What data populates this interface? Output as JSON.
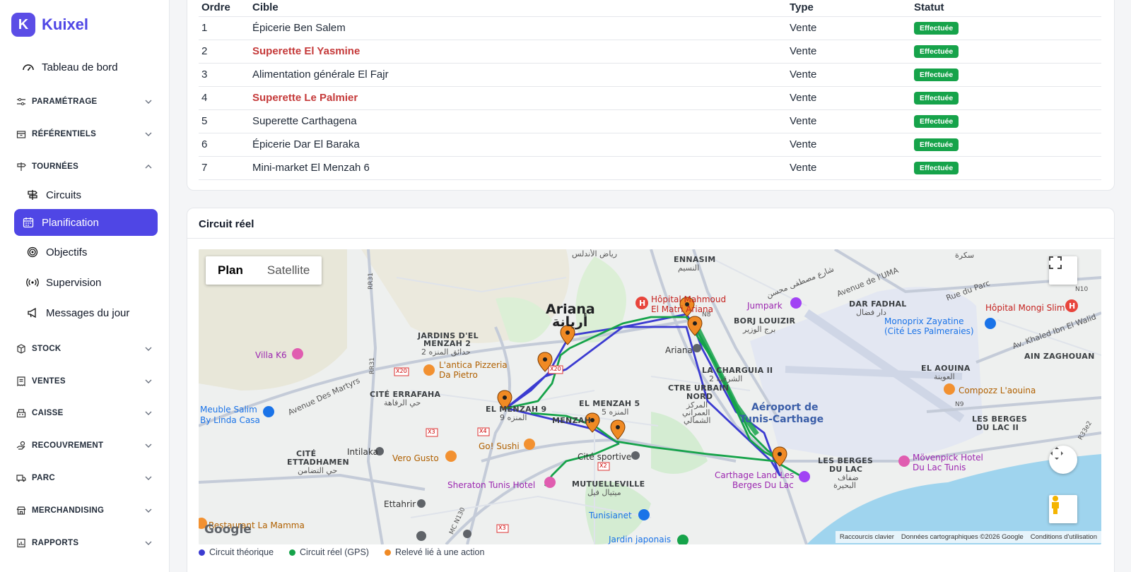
{
  "brand": {
    "logo_letter": "K",
    "name": "Kuixel",
    "color": "#4f46e5"
  },
  "sidebar": {
    "dashboard": "Tableau de bord",
    "sections": [
      {
        "label": "PARAMÉTRAGE",
        "expanded": false
      },
      {
        "label": "RÉFÉRENTIELS",
        "expanded": false
      },
      {
        "label": "TOURNÉES",
        "expanded": true
      },
      {
        "label": "STOCK",
        "expanded": false
      },
      {
        "label": "VENTES",
        "expanded": false
      },
      {
        "label": "CAISSE",
        "expanded": false
      },
      {
        "label": "RECOUVREMENT",
        "expanded": false
      },
      {
        "label": "PARC",
        "expanded": false
      },
      {
        "label": "MERCHANDISING",
        "expanded": false
      },
      {
        "label": "RAPPORTS",
        "expanded": false
      }
    ],
    "tournees_items": [
      {
        "label": "Circuits",
        "icon": "signpost-icon"
      },
      {
        "label": "Planification",
        "icon": "calendar-icon",
        "active": true
      },
      {
        "label": "Objectifs",
        "icon": "target-icon"
      },
      {
        "label": "Supervision",
        "icon": "broadcast-icon"
      },
      {
        "label": "Messages du jour",
        "icon": "megaphone-icon"
      }
    ]
  },
  "visits_table": {
    "headers": {
      "ordre": "Ordre",
      "cible": "Cible",
      "type": "Type",
      "statut": "Statut"
    },
    "rows": [
      {
        "ordre": "1",
        "cible": "Épicerie Ben Salem",
        "type": "Vente",
        "statut": "Effectuée",
        "highlight": false
      },
      {
        "ordre": "2",
        "cible": "Superette El Yasmine",
        "type": "Vente",
        "statut": "Effectuée",
        "highlight": true
      },
      {
        "ordre": "3",
        "cible": "Alimentation générale El Fajr",
        "type": "Vente",
        "statut": "Effectuée",
        "highlight": false
      },
      {
        "ordre": "4",
        "cible": "Superette Le Palmier",
        "type": "Vente",
        "statut": "Effectuée",
        "highlight": true
      },
      {
        "ordre": "5",
        "cible": "Superette Carthagena",
        "type": "Vente",
        "statut": "Effectuée",
        "highlight": false
      },
      {
        "ordre": "6",
        "cible": "Épicerie Dar El Baraka",
        "type": "Vente",
        "statut": "Effectuée",
        "highlight": false
      },
      {
        "ordre": "7",
        "cible": "Mini-market El Menzah 6",
        "type": "Vente",
        "statut": "Effectuée",
        "highlight": false
      }
    ],
    "status_color": "#16a34a",
    "highlight_color": "#c53a3a"
  },
  "map_card": {
    "title": "Circuit réel",
    "map_type": {
      "plan": "Plan",
      "satellite": "Satellite",
      "selected": "plan"
    },
    "google": "Google",
    "attribution": {
      "shortcuts": "Raccourcis clavier",
      "data": "Données cartographiques ©2026 Google",
      "terms": "Conditions d'utilisation"
    },
    "labels": {
      "ariana": "Ariana",
      "ariana_ar": "أريانة",
      "riadh": "رياض الأندلس",
      "ennasim": "ENNASIM",
      "ennasim_ar": "النسيم",
      "hopital_mahmoud": "Hôpital Mahmoud",
      "hopital_mahmoud2": "El Matri Ariana",
      "jumpark": "Jumpark",
      "borj": "BORJ LOUIZIR",
      "borj_ar": "برج الوزير",
      "dar_fadhal": "DAR FADHAL",
      "dar_fadhal_ar": "دار فضال",
      "hopital_mongi": "Hôpital Mongi Slim",
      "monoprix": "Monoprix Zayatine",
      "monoprix2": "(Cité Les Palmeraies)",
      "jardins": "JARDINS D'EL",
      "jardins2": "MENZAH 2",
      "jardins_ar": "حدائق المنزه 2",
      "villa": "Villa K6",
      "antica": "L'antica Pizzeria",
      "antica2": "Da Pietro",
      "cite_errafaha": "CITÉ ERRAFAHA",
      "cite_errafaha_ar": "حي الرفاهة",
      "el_menzah9": "EL MENZAH 9",
      "el_menzah9_ar": "المنزه 9",
      "el_menzah5": "EL MENZAH 5",
      "el_menzah5_ar": "المنزه 5",
      "ariana_m": "Ariana",
      "charguia": "LA CHARGUIA II",
      "charguia_ar": "الشرقية 2",
      "ctre_urbain": "CTRE URBAIN",
      "ctre_urbain2": "NORD",
      "ctre_ar": "المركز",
      "ctre_ar2": "العمراني",
      "ctre_ar3": "الشمالي",
      "aeroport": "Aéroport de",
      "aeroport2": "Tunis-Carthage",
      "el_aouina": "EL AOUINA",
      "el_aouina_ar": "العوينة",
      "ain_zaghouan": "AIN ZAGHOUAN",
      "compozz": "Compozz L'aouina",
      "berges2": "LES BERGES",
      "berges2b": "DU LAC II",
      "meuble": "Meuble Salim",
      "meuble2": "By Linda Casa",
      "avenue_martyrs": "Avenue Des Martyrs",
      "cite_ettadhamen": "CITÉ",
      "cite_ettadhamen2": "ETTADHAMEN",
      "cite_ettadhamen_ar": "حي التضامن",
      "intilaka": "Intilaka",
      "vero": "Vero Gusto",
      "gosushi": "Go! Sushi",
      "cite_sportive": "Cité sportive",
      "sheraton": "Sheraton Tunis Hotel",
      "mutuelleville": "MUTUELLEVILLE",
      "mutuelleville_ar": "ميتيال فيل",
      "ettahrir": "Ettahrir",
      "tunisianet": "Tunisianet",
      "jardin_jap": "Jardin japonais",
      "restaurant": "Restaurant La Mamma",
      "berges": "LES BERGES",
      "berges_b": "DU LAC",
      "berges_ar": "ضفاف",
      "berges_ar2": "البحيرة",
      "carthage_land": "Carthage Land Les",
      "carthage_land2": "Berges Du Lac",
      "movenpick": "Mövenpick Hotel",
      "movenpick2": "Du Lac Tunis",
      "rue_parc": "Rue du Parc",
      "av_uma": "Avenue de l'UMA",
      "av_khaled": "Av. Khaled Ibn El Walid",
      "chareh": "شارع مصطفى محسن",
      "menzah_dup": "MENZAH",
      "sokra": "سكرة",
      "x20": "X20",
      "x3a": "X3",
      "x4": "X4",
      "x2": "X2",
      "x3b": "X3",
      "x20b": "X20",
      "n8": "N8",
      "n9": "N9",
      "n10": "N10",
      "rr31": "RR31",
      "rr31b": "RR31",
      "rr33": "R33e2",
      "mcn": "MC N130"
    }
  },
  "legend": [
    {
      "label": "Circuit théorique",
      "color": "#3b3bd1"
    },
    {
      "label": "Circuit réel (GPS)",
      "color": "#16a34a"
    },
    {
      "label": "Relevé lié à une action",
      "color": "#f08a24"
    }
  ]
}
